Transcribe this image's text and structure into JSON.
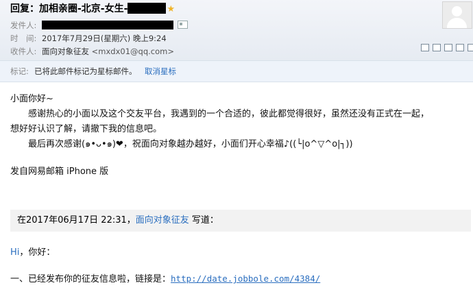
{
  "email": {
    "subject": "回复：加相亲圈-北京-女生-",
    "sender_label": "发件人:",
    "time_label": "时　间:",
    "time_value": "2017年7月29日(星期六) 晚上9:24",
    "recipient_label": "收件人:",
    "recipient_name": "面向对象征友",
    "recipient_email": "<mxdx01@qq.com>"
  },
  "flag": {
    "label": "标记:",
    "message": "已将此邮件标记为星标邮件。",
    "action": "取消星标"
  },
  "body": {
    "greeting": "小面你好~",
    "para1_line1": "　　感谢热心的小面以及这个交友平台，我遇到的一个合适的，彼此都觉得很好，虽然还没有正式在一起，",
    "para1_line2": "想好好认识了解，请撤下我的信息吧。",
    "para2": "　　最后再次感谢(๑•ᴗ•๑)❤，祝面向对象越办越好，小面们开心幸福♪((└|o^▽^o|┐))",
    "signature": "发自网易邮箱 iPhone 版"
  },
  "quote": {
    "prefix": "在2017年06月17日 22:31，",
    "author": "面向对象征友",
    "suffix": " 写道："
  },
  "reply": {
    "hi": "Hi",
    "hi_rest": "，你好：",
    "line1_text": "一、已经发布你的征友信息啦，链接是：",
    "line1_link": "http://date.jobbole.com/4384/"
  },
  "icons": [
    "redacted-bar",
    "star-icon",
    "vcard-icon",
    "avatar-placeholder",
    "new-window-icon",
    "print-icon",
    "download-icon",
    "more-icon",
    "expand-icon"
  ]
}
